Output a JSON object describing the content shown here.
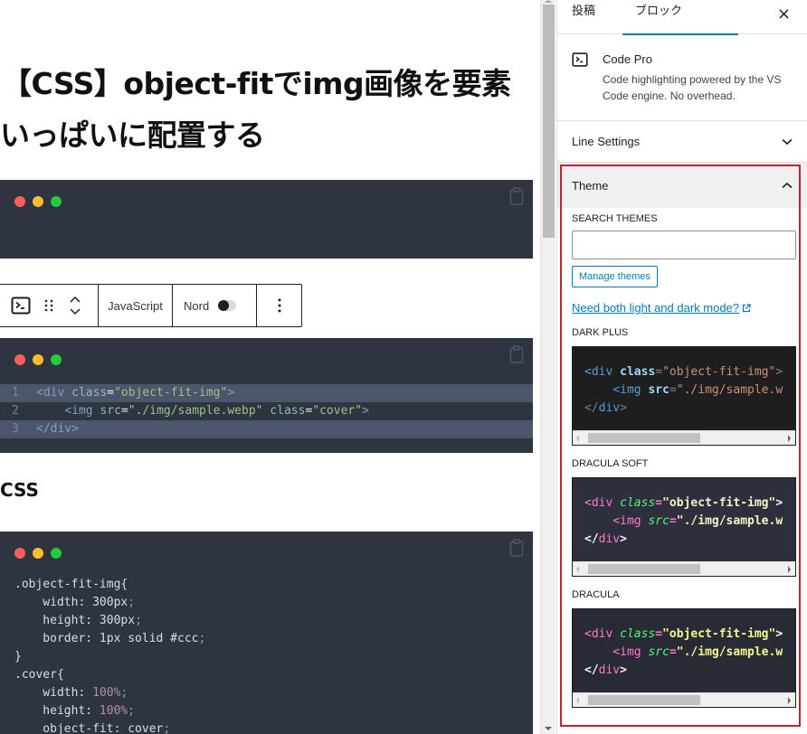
{
  "post": {
    "title_line1": "【CSS】object-fitでimg画像を要素",
    "title_line2": "いっぱいに配置する",
    "section_heading": "CSS"
  },
  "code_blocks": {
    "html_lines": [
      {
        "num": "1",
        "indent": "",
        "tokens": [
          [
            "t-tag",
            "<div "
          ],
          [
            "t-attr",
            "class"
          ],
          [
            "t-punc",
            "="
          ],
          [
            "t-str",
            "\"object-fit-img\""
          ],
          [
            "t-tag",
            ">"
          ]
        ]
      },
      {
        "num": "2",
        "indent": "    ",
        "tokens": [
          [
            "t-tag",
            "<img "
          ],
          [
            "t-attr",
            "src"
          ],
          [
            "t-punc",
            "="
          ],
          [
            "t-str",
            "\"./img/sample.webp\""
          ],
          [
            "t-punc",
            " "
          ],
          [
            "t-attr",
            "class"
          ],
          [
            "t-punc",
            "="
          ],
          [
            "t-str",
            "\"cover\""
          ],
          [
            "t-tag",
            ">"
          ]
        ]
      },
      {
        "num": "3",
        "indent": "",
        "tokens": [
          [
            "t-tag",
            "</div>"
          ]
        ]
      }
    ],
    "css_lines": [
      [
        [
          "t-sel",
          ".object-fit-img{"
        ]
      ],
      [
        [
          "t-prop",
          "    width: 300px"
        ],
        [
          "t-semi",
          ";"
        ]
      ],
      [
        [
          "t-prop",
          "    height: 300px"
        ],
        [
          "t-semi",
          ";"
        ]
      ],
      [
        [
          "t-prop",
          "    border: 1px solid #ccc"
        ],
        [
          "t-semi",
          ";"
        ]
      ],
      [
        [
          "t-sel",
          "}"
        ]
      ],
      [
        [
          "t-sel",
          ".cover{"
        ]
      ],
      [
        [
          "t-prop",
          "    width: "
        ],
        [
          "t-num",
          "100%"
        ],
        [
          "t-semi",
          ";"
        ]
      ],
      [
        [
          "t-prop",
          "    height: "
        ],
        [
          "t-num",
          "100%"
        ],
        [
          "t-semi",
          ";"
        ]
      ],
      [
        [
          "t-prop",
          "    object-fit: cover"
        ],
        [
          "t-semi",
          ";"
        ]
      ]
    ],
    "highlighted_lines": [
      1,
      3
    ],
    "window_dots": [
      "#ff5f56",
      "#ffbd2e",
      "#27c93f"
    ]
  },
  "block_toolbar": {
    "language": "JavaScript",
    "theme": "Nord",
    "icons": [
      "terminal-icon",
      "drag-handle-icon",
      "chevron-up-icon",
      "chevron-down-icon",
      "more-options-icon"
    ]
  },
  "sidebar": {
    "tabs": [
      {
        "label": "投稿",
        "active": false
      },
      {
        "label": "ブロック",
        "active": true
      }
    ],
    "close_label": "×",
    "block": {
      "title": "Code Pro",
      "description": "Code highlighting powered by the VS Code engine. No overhead."
    },
    "panels": {
      "line_settings": "Line Settings",
      "theme": "Theme"
    },
    "theme_panel": {
      "search_label": "SEARCH THEMES",
      "search_value": "",
      "search_placeholder": "",
      "manage_button": "Manage themes",
      "dark_mode_link": "Need both light and dark mode?",
      "themes": [
        {
          "name": "DARK PLUS",
          "line1": [
            "<div ",
            "class",
            "=",
            "\"object-fit-img\"",
            ">"
          ],
          "line2": [
            "    <img ",
            "src",
            "=",
            "\"./img/sample.w"
          ],
          "line3": [
            "</",
            "div",
            ">"
          ]
        },
        {
          "name": "DRACULA SOFT",
          "line1": [
            "<div ",
            "class",
            "=",
            "\"object-fit-img\"",
            ">"
          ],
          "line2": [
            "    <img ",
            "src",
            "=",
            "\"./img/sample.w"
          ],
          "line3": [
            "</",
            "div",
            ">"
          ]
        },
        {
          "name": "DRACULA",
          "line1": [
            "<div ",
            "class",
            "=",
            "\"object-fit-img\"",
            ">"
          ],
          "line2": [
            "    <img ",
            "src",
            "=",
            "\"./img/sample.w"
          ],
          "line3": [
            "</",
            "div",
            ">"
          ]
        }
      ]
    }
  },
  "colors": {
    "accent": "#007cba",
    "highlight_border": "#c4232b",
    "nord_bg": "#2e3440",
    "nord_line_highlight": "#4c566a"
  }
}
